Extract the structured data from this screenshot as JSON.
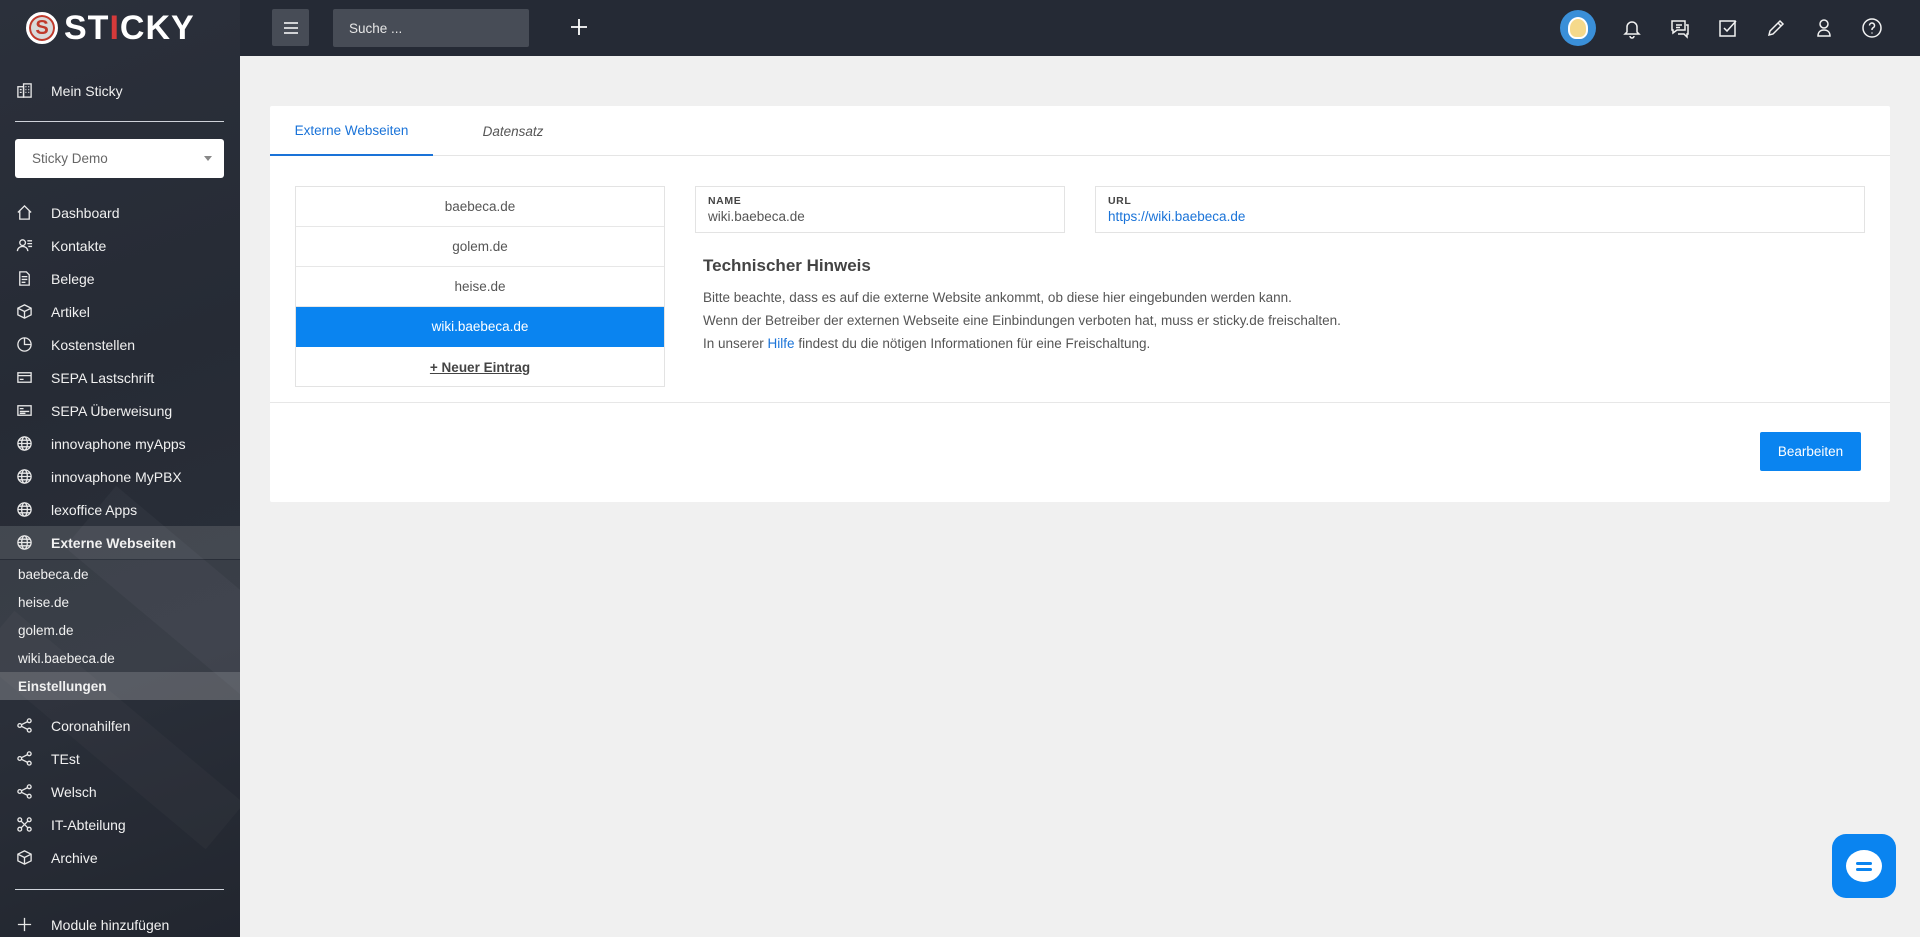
{
  "brand": {
    "name_prefix": "ST",
    "name_highlight": "I",
    "name_suffix": "CKY",
    "badge": "S"
  },
  "topbar": {
    "search_placeholder": "Suche ...",
    "icons": [
      "user-avatar",
      "bell-icon",
      "chat-icon",
      "checkbox-icon",
      "pencil-icon",
      "user-icon",
      "help-icon"
    ]
  },
  "sidebar": {
    "home_label": "Mein Sticky",
    "company_select": "Sticky Demo",
    "items": [
      {
        "label": "Dashboard",
        "icon": "home-icon"
      },
      {
        "label": "Kontakte",
        "icon": "contacts-icon"
      },
      {
        "label": "Belege",
        "icon": "document-icon"
      },
      {
        "label": "Artikel",
        "icon": "box-icon"
      },
      {
        "label": "Kostenstellen",
        "icon": "pie-icon"
      },
      {
        "label": "SEPA Lastschrift",
        "icon": "card-icon"
      },
      {
        "label": "SEPA Überweisung",
        "icon": "transfer-icon"
      },
      {
        "label": "innovaphone myApps",
        "icon": "globe-icon"
      },
      {
        "label": "innovaphone MyPBX",
        "icon": "globe-icon"
      },
      {
        "label": "lexoffice Apps",
        "icon": "globe-icon"
      },
      {
        "label": "Externe Webseiten",
        "icon": "globe-icon"
      }
    ],
    "sub_items": [
      {
        "label": "baebeca.de"
      },
      {
        "label": "heise.de"
      },
      {
        "label": "golem.de"
      },
      {
        "label": "wiki.baebeca.de"
      },
      {
        "label": "Einstellungen"
      }
    ],
    "more_items": [
      {
        "label": "Coronahilfen",
        "icon": "share-icon"
      },
      {
        "label": "TEst",
        "icon": "share-icon"
      },
      {
        "label": "Welsch",
        "icon": "share-icon"
      },
      {
        "label": "IT-Abteilung",
        "icon": "network-icon"
      },
      {
        "label": "Archive",
        "icon": "box-icon"
      }
    ],
    "add_modules": "Module hinzufügen"
  },
  "main": {
    "tabs": [
      {
        "label": "Externe Webseiten"
      },
      {
        "label": "Datensatz"
      }
    ],
    "sites": [
      {
        "label": "baebeca.de"
      },
      {
        "label": "golem.de"
      },
      {
        "label": "heise.de"
      },
      {
        "label": "wiki.baebeca.de"
      }
    ],
    "new_entry": "+ Neuer Eintrag",
    "name_label": "NAME",
    "name_value": "wiki.baebeca.de",
    "url_label": "URL",
    "url_value": "https://wiki.baebeca.de",
    "notice": {
      "title": "Technischer Hinweis",
      "line1": "Bitte beachte, dass es auf die externe Website ankommt, ob diese hier eingebunden werden kann.",
      "line2": "Wenn der Betreiber der externen Webseite eine Einbindungen verboten hat, muss er sticky.de freischalten.",
      "line3_pre": "In unserer ",
      "line3_link": "Hilfe",
      "line3_post": " findest du die nötigen Informationen für eine Freischaltung."
    },
    "edit_button": "Bearbeiten"
  },
  "colors": {
    "accent": "#0a84f0",
    "sidebar_bg": "#2b303b",
    "topbar_bg": "#252a35",
    "brand_red": "#d63a3a"
  }
}
